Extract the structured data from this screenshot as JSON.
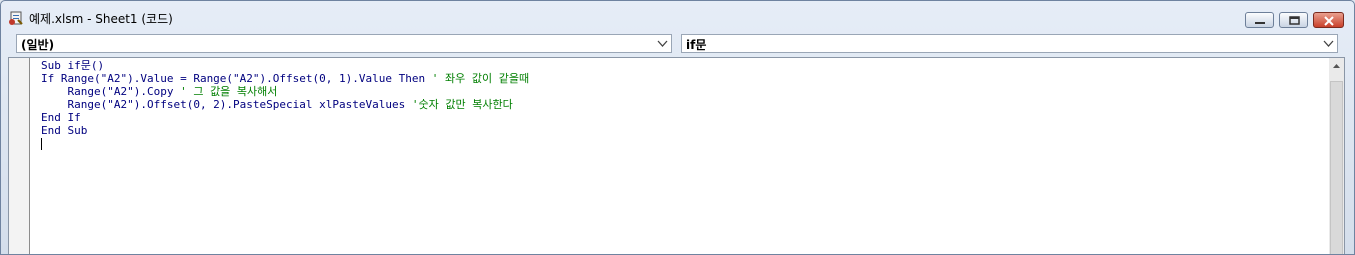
{
  "window": {
    "title": "예제.xlsm - Sheet1 (코드)",
    "icon": "vba-module-icon"
  },
  "combos": {
    "object": "(일반)",
    "procedure": "if문"
  },
  "code": {
    "lines": [
      [
        {
          "t": "Sub if문()",
          "k": "kw"
        }
      ],
      [
        {
          "t": "If Range(\"A2\").Value = Range(\"A2\").Offset(0, 1).Value Then ",
          "k": "kw"
        },
        {
          "t": "' 좌우 값이 같을때",
          "k": "cm"
        }
      ],
      [
        {
          "t": "    Range(\"A2\").Copy ",
          "k": "kw"
        },
        {
          "t": "' 그 값을 복사해서",
          "k": "cm"
        }
      ],
      [
        {
          "t": "    Range(\"A2\").Offset(0, 2).PasteSpecial xlPasteValues ",
          "k": "kw"
        },
        {
          "t": "'숫자 값만 복사한다",
          "k": "cm"
        }
      ],
      [
        {
          "t": "End If",
          "k": "kw"
        }
      ],
      [
        {
          "t": "End Sub",
          "k": "kw"
        }
      ]
    ]
  },
  "colors": {
    "keyword": "#00007f",
    "comment": "#007f00",
    "close_button": "#c9402a"
  }
}
